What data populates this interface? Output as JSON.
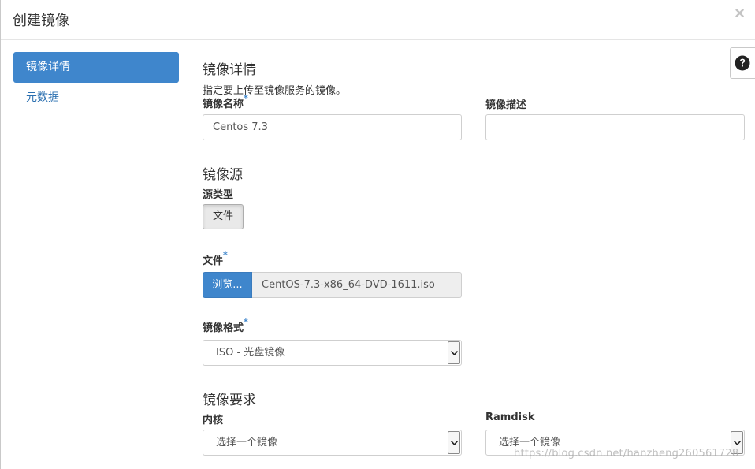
{
  "modal": {
    "title": "创建镜像",
    "close_symbol": "×"
  },
  "sidebar": {
    "items": [
      {
        "label": "镜像详情",
        "active": true
      },
      {
        "label": "元数据",
        "active": false
      }
    ]
  },
  "help": {
    "icon": "question-circle-icon"
  },
  "details": {
    "title": "镜像详情",
    "help_text": "指定要上传至镜像服务的镜像。",
    "name_label": "镜像名称",
    "name_value": "Centos 7.3",
    "description_label": "镜像描述",
    "description_value": ""
  },
  "source": {
    "title": "镜像源",
    "type_label": "源类型",
    "type_button": "文件",
    "file_label": "文件",
    "browse_label": "浏览...",
    "file_name": "CentOS-7.3-x86_64-DVD-1611.iso",
    "format_label": "镜像格式",
    "format_value": "ISO - 光盘镜像"
  },
  "requirements": {
    "title": "镜像要求",
    "kernel_label": "内核",
    "kernel_value": "选择一个镜像",
    "ramdisk_label": "Ramdisk",
    "ramdisk_value": "选择一个镜像"
  },
  "required_marker": "*",
  "watermark": "https://blog.csdn.net/hanzheng260561728",
  "colors": {
    "accent": "#3f86cc",
    "link": "#2a6fb0"
  }
}
